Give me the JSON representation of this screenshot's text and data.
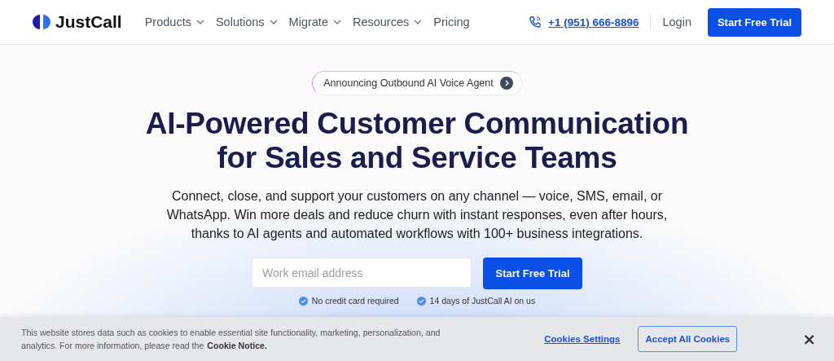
{
  "header": {
    "logo": "JustCall",
    "nav": [
      {
        "label": "Products",
        "dropdown": true
      },
      {
        "label": "Solutions",
        "dropdown": true
      },
      {
        "label": "Migrate",
        "dropdown": true
      },
      {
        "label": "Resources",
        "dropdown": true
      },
      {
        "label": "Pricing",
        "dropdown": false
      }
    ],
    "phone": "+1 (951) 666-8896",
    "login": "Login",
    "cta": "Start Free Trial"
  },
  "hero": {
    "announcement": "Announcing Outbound AI Voice Agent",
    "title_lines": [
      "AI-Powered Customer Communication",
      "for Sales and Service Teams"
    ],
    "description": "Connect, close, and support your customers on any channel — voice, SMS, email, or WhatsApp. Win more deals and reduce churn with instant responses, even after hours, thanks to AI agents and automated workflows with 100+ business integrations.",
    "email": {
      "placeholder": "Work email address"
    },
    "cta": "Start Free Trial",
    "perks": [
      "No credit card required",
      "14 days of JustCall AI on us"
    ]
  },
  "cookie_banner": {
    "text": "This website stores data such as cookies to enable essential site functionality, marketing, personalization, and analytics. For more information, please read the",
    "link": "Cookie Notice.",
    "settings": "Cookies Settings",
    "accept": "Accept All Cookies",
    "close": "×"
  }
}
